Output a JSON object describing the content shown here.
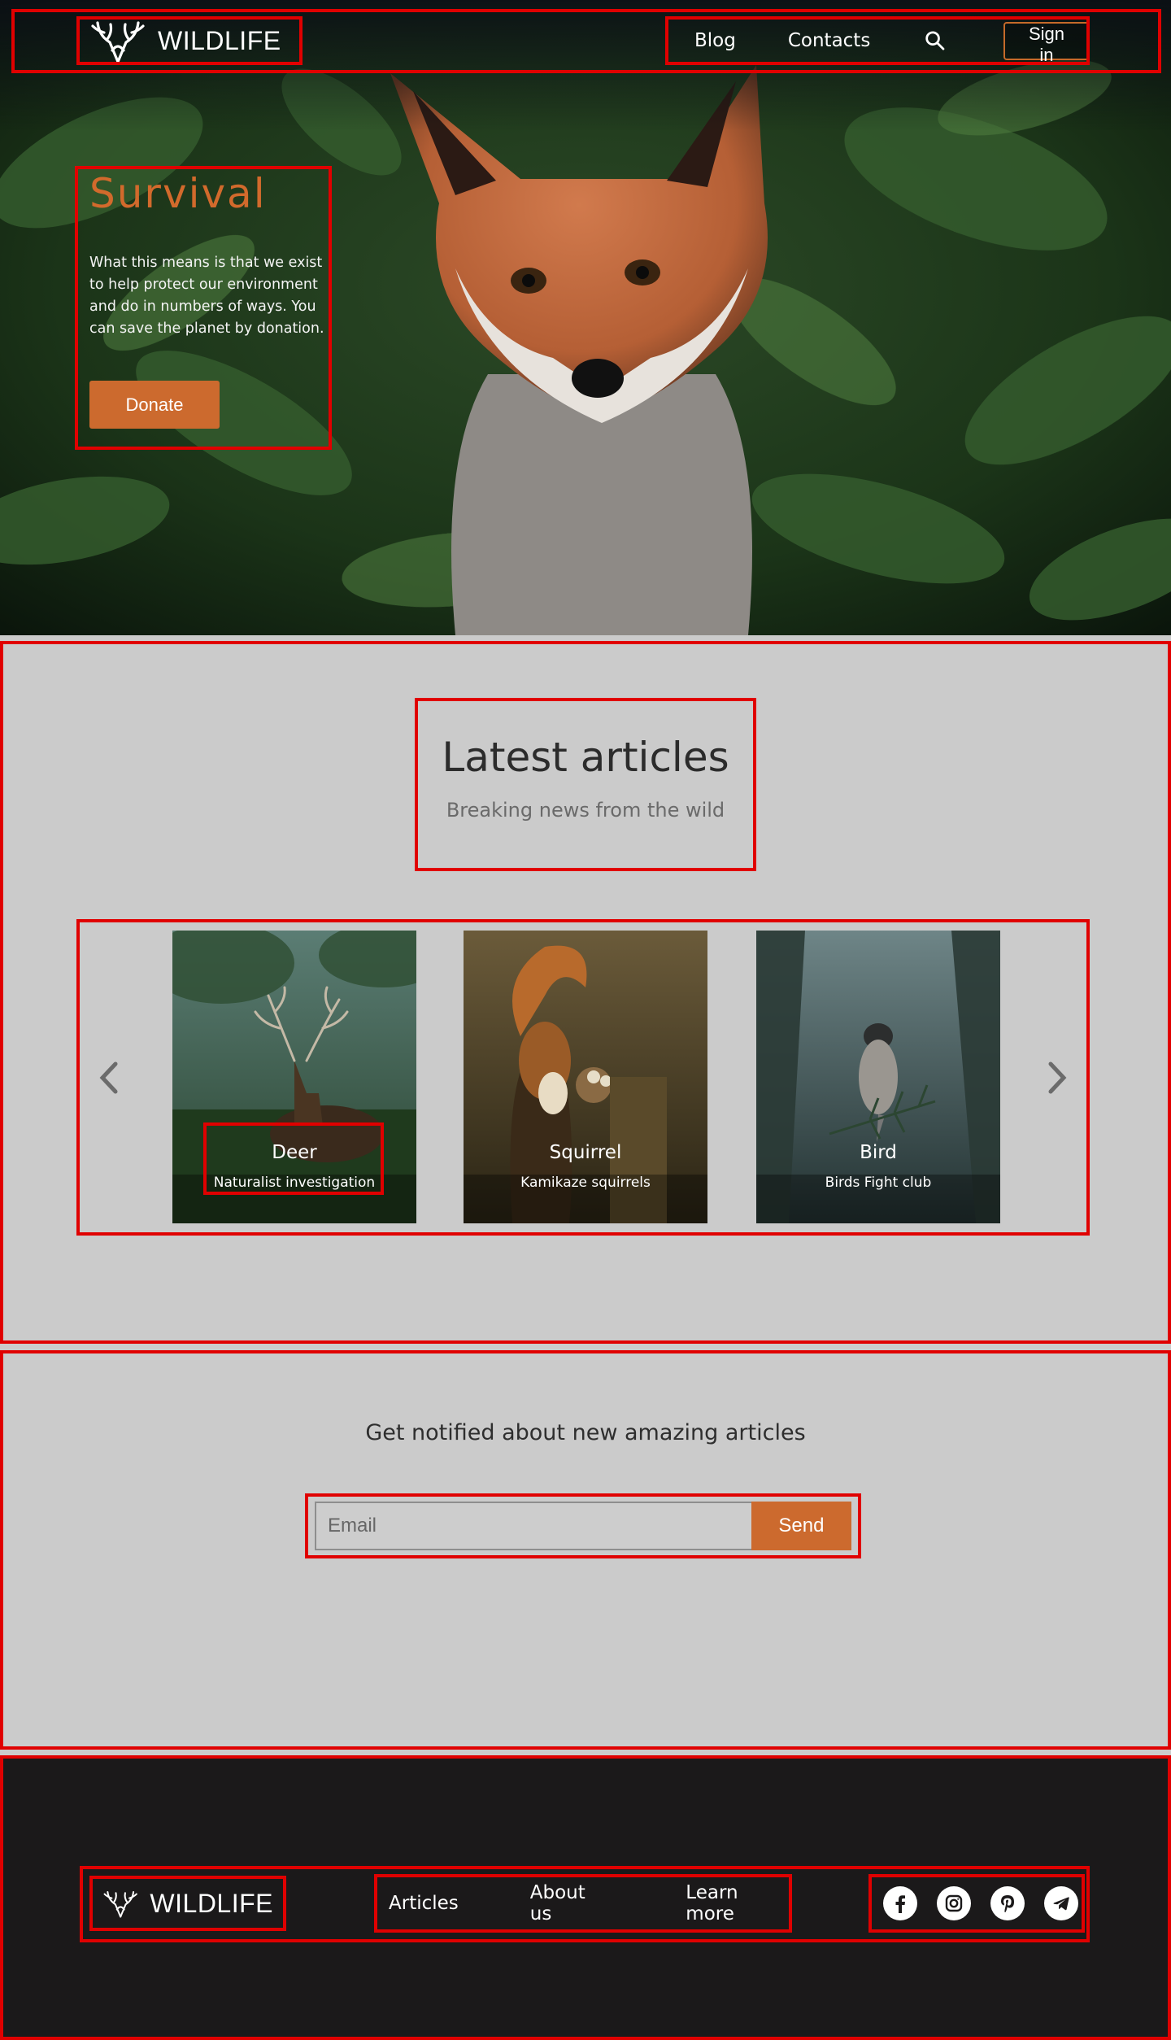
{
  "brand": {
    "name": "WILDLIFE",
    "accent": "#cc6a2e"
  },
  "nav": {
    "blog": "Blog",
    "contacts": "Contacts",
    "search_icon": "search-icon",
    "sign_in": "Sign in"
  },
  "hero": {
    "title": "Survival",
    "text": "What this means is that we exist to help protect our environment and do in numbers of ways. You can save the planet by donation.",
    "donate": "Donate"
  },
  "articles": {
    "title": "Latest articles",
    "subtitle": "Breaking news from the wild",
    "cards": [
      {
        "name": "Deer",
        "subtitle": "Naturalist investigation"
      },
      {
        "name": "Squirrel",
        "subtitle": "Kamikaze squirrels"
      },
      {
        "name": "Bird",
        "subtitle": "Birds Fight club"
      }
    ]
  },
  "newsletter": {
    "title": "Get notified about new amazing articles",
    "placeholder": "Email",
    "send": "Send"
  },
  "footer": {
    "brand": "WILDLIFE",
    "links": [
      "Articles",
      "About us",
      "Learn more"
    ],
    "socials": [
      "facebook-icon",
      "instagram-icon",
      "pinterest-icon",
      "telegram-icon"
    ]
  }
}
